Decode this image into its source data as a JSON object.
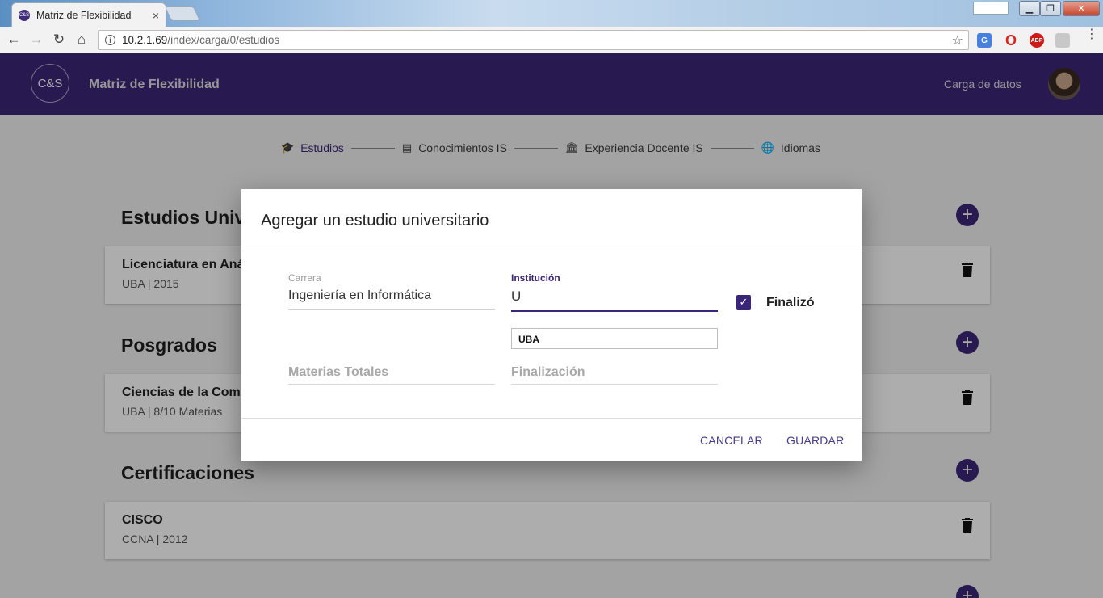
{
  "browser": {
    "tab_title": "Matriz de Flexibilidad",
    "tab_favicon": "C&S",
    "tab_close": "×",
    "url_host": "10.2.1.69",
    "url_path": "/index/carga/0/estudios"
  },
  "header": {
    "logo": "C&S",
    "title": "Matriz de Flexibilidad",
    "nav_link": "Carga de datos"
  },
  "stepper": [
    {
      "label": "Estudios",
      "icon": "graduation-cap-icon"
    },
    {
      "label": "Conocimientos IS",
      "icon": "list-icon"
    },
    {
      "label": "Experiencia Docente IS",
      "icon": "bank-icon"
    },
    {
      "label": "Idiomas",
      "icon": "globe-icon"
    }
  ],
  "sections": [
    {
      "title": "Estudios Universitarios",
      "card_title": "Licenciatura en Análisis de Sistemas",
      "card_sub": "UBA | 2015"
    },
    {
      "title": "Posgrados",
      "card_title": "Ciencias de la Computación",
      "card_sub": "UBA | 8/10 Materias"
    },
    {
      "title": "Certificaciones",
      "card_title": "CISCO",
      "card_sub": "CCNA | 2012"
    }
  ],
  "dialog": {
    "title": "Agregar un estudio universitario",
    "carrera": {
      "label": "Carrera",
      "value": "Ingeniería en Informática"
    },
    "institucion": {
      "label": "Institución",
      "value": "U"
    },
    "autocomplete_option": "UBA",
    "materias_placeholder": "Materias Totales",
    "finalizacion_placeholder": "Finalización",
    "finalizo_label": "Finalizó",
    "finalizo_checked": true,
    "cancel_label": "CANCELAR",
    "save_label": "GUARDAR"
  },
  "colors": {
    "primary": "#3b2578"
  }
}
